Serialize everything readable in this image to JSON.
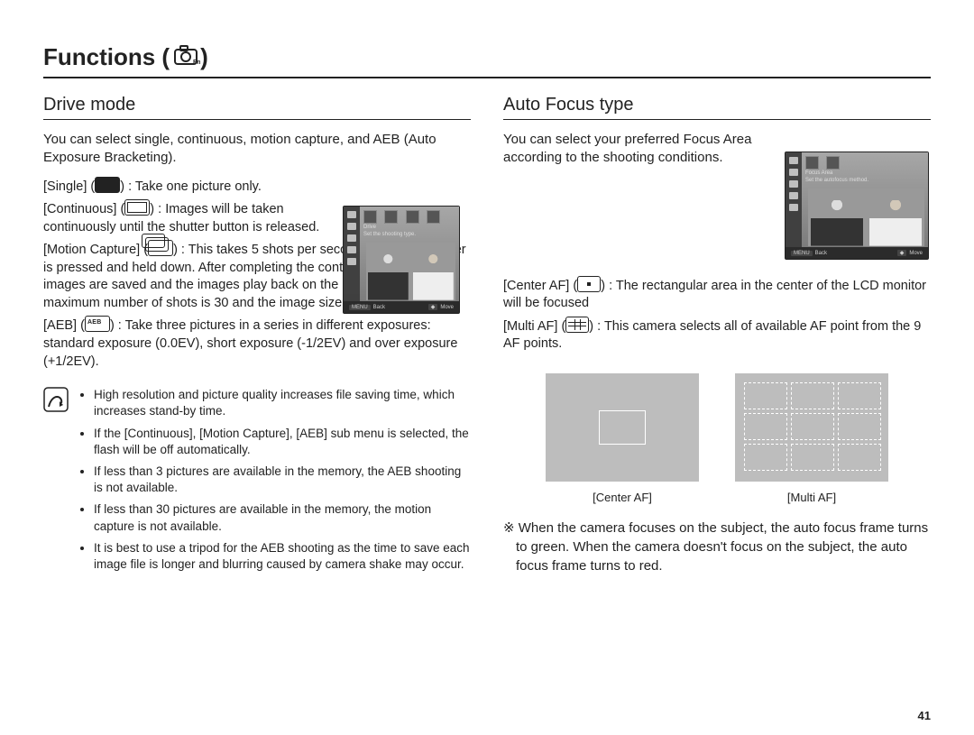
{
  "page_number": "41",
  "title": "Functions ( ",
  "title_end": " )",
  "left": {
    "heading": "Drive mode",
    "intro": "You can select single, continuous, motion capture, and AEB (Auto Exposure Bracketing).",
    "items": {
      "single": {
        "label": "[Single]",
        "desc": ": Take one picture only."
      },
      "continuous": {
        "label": "[Continuous]",
        "desc": ": Images will be taken continuously until the shutter button is released."
      },
      "motion": {
        "label": "[Motion Capture]",
        "desc": ": This takes 5 shots per second, when the shutter is pressed and held down. After completing the continuous shooting, images are saved and the images play back on the Rear LCD. The maximum number of shots is 30 and the image size is fixed as VGA."
      },
      "aeb": {
        "label": "[AEB]",
        "desc": ": Take three pictures in a series in different exposures: standard exposure (0.0EV), short exposure (-1/2EV) and over exposure (+1/2EV)."
      }
    },
    "notes": [
      "High resolution and picture quality increases file saving time, which increases stand-by time.",
      "If the [Continuous], [Motion Capture], [AEB] sub menu is selected, the flash will be off automatically.",
      "If less than 3 pictures are available in the memory, the AEB shooting is not available.",
      "If less than 30 pictures are available in the memory, the motion capture is not available.",
      "It is best to use a tripod for the AEB shooting as the time to save each image file is longer and blurring caused by camera shake may occur."
    ],
    "mini": {
      "drive_label": "Drive",
      "drive_sub": "Set the shooting type.",
      "back": "Back",
      "move": "Move"
    }
  },
  "right": {
    "heading": "Auto Focus type",
    "intro": "You can select your preferred Focus Area according to the shooting conditions.",
    "items": {
      "center": {
        "label": "[Center AF]",
        "desc": ": The rectangular area in the center of the LCD monitor will be focused"
      },
      "multi": {
        "label": "[Multi AF]",
        "desc": ": This camera selects all of available AF point from the 9 AF points."
      }
    },
    "mini": {
      "focus_label": "Focus Area",
      "focus_sub": "Set the autofocus method.",
      "back": "Back",
      "move": "Move"
    },
    "captions": {
      "center": "[Center AF]",
      "multi": "[Multi AF]"
    },
    "footnote": "※ When the camera focuses on the subject, the auto focus frame turns to green. When the camera doesn't focus on the subject, the auto focus frame turns to red."
  }
}
